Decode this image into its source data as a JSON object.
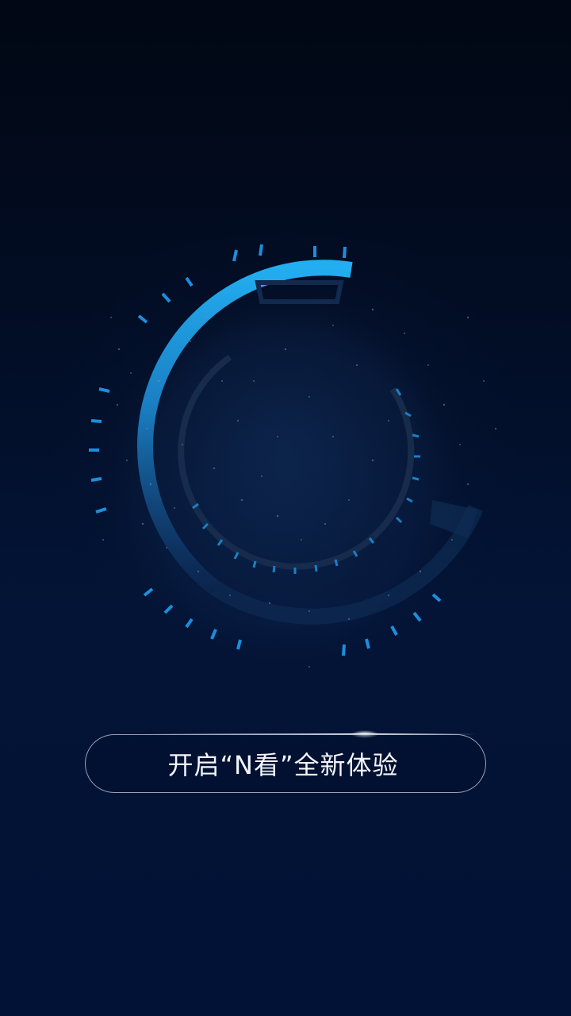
{
  "splash": {
    "cta_label": "开启“N看”全新体验"
  },
  "icons": {
    "hero": "circular-tech-dial-icon",
    "flare": "light-flare-icon"
  },
  "colors": {
    "background_top": "#010713",
    "background_bottom": "#021236",
    "accent_blue": "#1ea8e8",
    "button_border": "#c8d2e6",
    "button_text": "#f2f5fb"
  }
}
